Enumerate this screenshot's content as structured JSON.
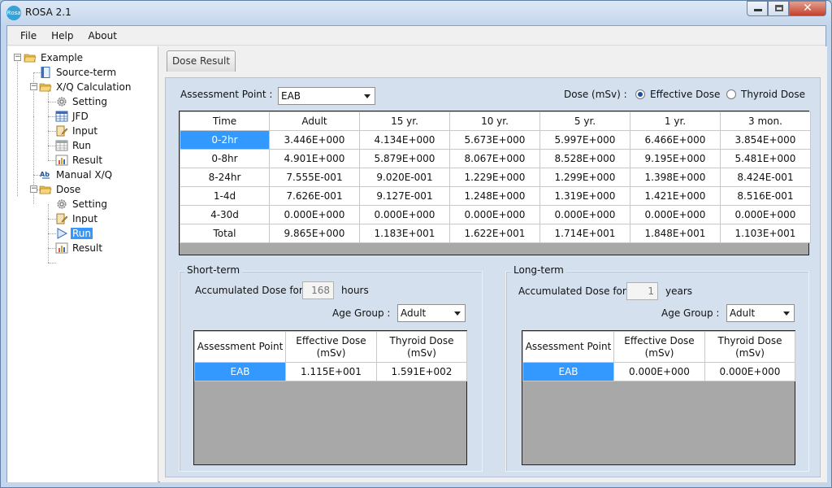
{
  "window": {
    "title": "ROSA 2.1",
    "logo_text": "Rosa",
    "close_glyph": "✕"
  },
  "menu": [
    "File",
    "Help",
    "About"
  ],
  "tree": {
    "root": "Example",
    "source_term": "Source-term",
    "xq": "X/Q Calculation",
    "xq_children": [
      "Setting",
      "JFD",
      "Input",
      "Run",
      "Result"
    ],
    "manual_xq": "Manual X/Q",
    "dose": "Dose",
    "dose_children": [
      "Setting",
      "Input",
      "Run",
      "Result"
    ]
  },
  "tab": "Dose Result",
  "assessment": {
    "label": "Assessment Point :",
    "value": "EAB"
  },
  "dose_select": {
    "label": "Dose (mSv) :",
    "options": [
      {
        "label": "Effective Dose",
        "selected": true
      },
      {
        "label": "Thyroid Dose",
        "selected": false
      }
    ]
  },
  "result_table": {
    "columns": [
      "Time",
      "Adult",
      "15 yr.",
      "10 yr.",
      "5 yr.",
      "1 yr.",
      "3 mon."
    ],
    "rows": [
      [
        "0-2hr",
        "3.446E+000",
        "4.134E+000",
        "5.673E+000",
        "5.997E+000",
        "6.466E+000",
        "3.854E+000"
      ],
      [
        "0-8hr",
        "4.901E+000",
        "5.879E+000",
        "8.067E+000",
        "8.528E+000",
        "9.195E+000",
        "5.481E+000"
      ],
      [
        "8-24hr",
        "7.555E-001",
        "9.020E-001",
        "1.229E+000",
        "1.299E+000",
        "1.398E+000",
        "8.424E-001"
      ],
      [
        "1-4d",
        "7.626E-001",
        "9.127E-001",
        "1.248E+000",
        "1.319E+000",
        "1.421E+000",
        "8.516E-001"
      ],
      [
        "4-30d",
        "0.000E+000",
        "0.000E+000",
        "0.000E+000",
        "0.000E+000",
        "0.000E+000",
        "0.000E+000"
      ],
      [
        "Total",
        "9.865E+000",
        "1.183E+001",
        "1.622E+001",
        "1.714E+001",
        "1.848E+001",
        "1.103E+001"
      ]
    ]
  },
  "short_term": {
    "title": "Short-term",
    "accum_label": "Accumulated Dose for",
    "accum_value": "168",
    "unit": "hours",
    "age_label": "Age Group :",
    "age_value": "Adult",
    "columns": [
      "Assessment Point",
      "Effective Dose (mSv)",
      "Thyroid Dose (mSv)"
    ],
    "row": [
      "EAB",
      "1.115E+001",
      "1.591E+002"
    ]
  },
  "long_term": {
    "title": "Long-term",
    "accum_label": "Accumulated Dose for",
    "accum_value": "1",
    "unit": "years",
    "age_label": "Age Group :",
    "age_value": "Adult",
    "columns": [
      "Assessment Point",
      "Effective Dose (mSv)",
      "Thyroid Dose (mSv)"
    ],
    "row": [
      "EAB",
      "0.000E+000",
      "0.000E+000"
    ]
  },
  "colors": {
    "selection": "#3399ff",
    "panel": "#d4e0ee",
    "grid_empty": "#a8a8a8"
  }
}
